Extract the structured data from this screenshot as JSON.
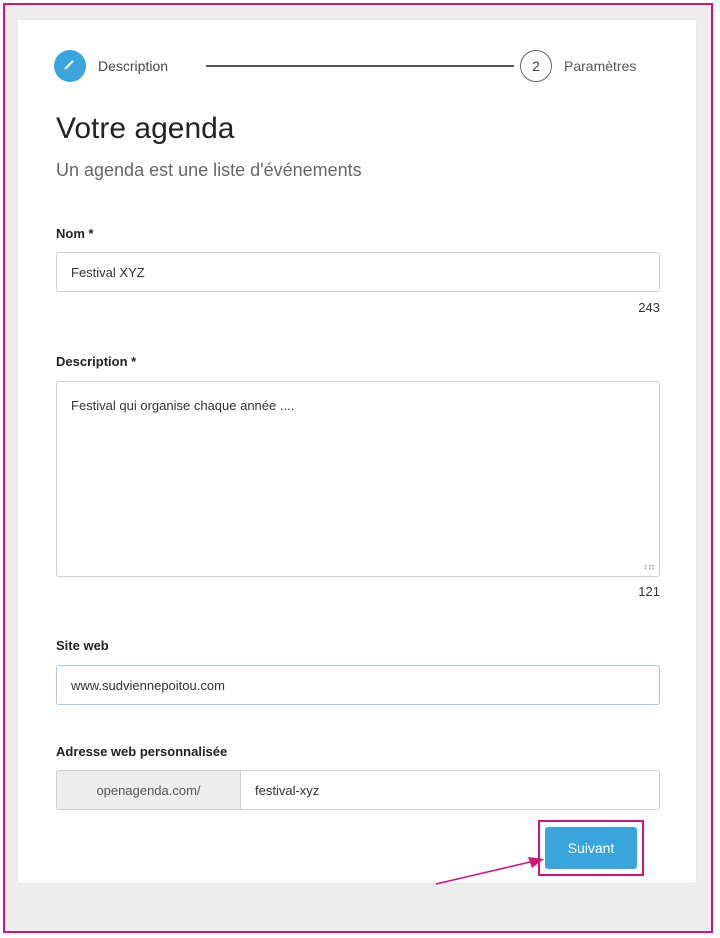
{
  "stepper": {
    "step1_label": "Description",
    "step2_number": "2",
    "step2_label": "Paramètres"
  },
  "header": {
    "title": "Votre agenda",
    "subtitle": "Un agenda est une liste d'événements"
  },
  "form": {
    "name": {
      "label": "Nom *",
      "value": "Festival XYZ",
      "counter": "243"
    },
    "description": {
      "label": "Description *",
      "value": "Festival qui organise chaque année ....",
      "counter": "121"
    },
    "website": {
      "label": "Site web",
      "value": "www.sudviennepoitou.com"
    },
    "custom_url": {
      "label": "Adresse web personnalisée",
      "prefix": "openagenda.com/",
      "value": "festival-xyz"
    }
  },
  "actions": {
    "next_label": "Suivant"
  },
  "colors": {
    "accent": "#3aa4dd",
    "highlight": "#d1157a"
  },
  "icons": {
    "step1": "pencil-icon",
    "annotation": "arrow-annotation"
  }
}
